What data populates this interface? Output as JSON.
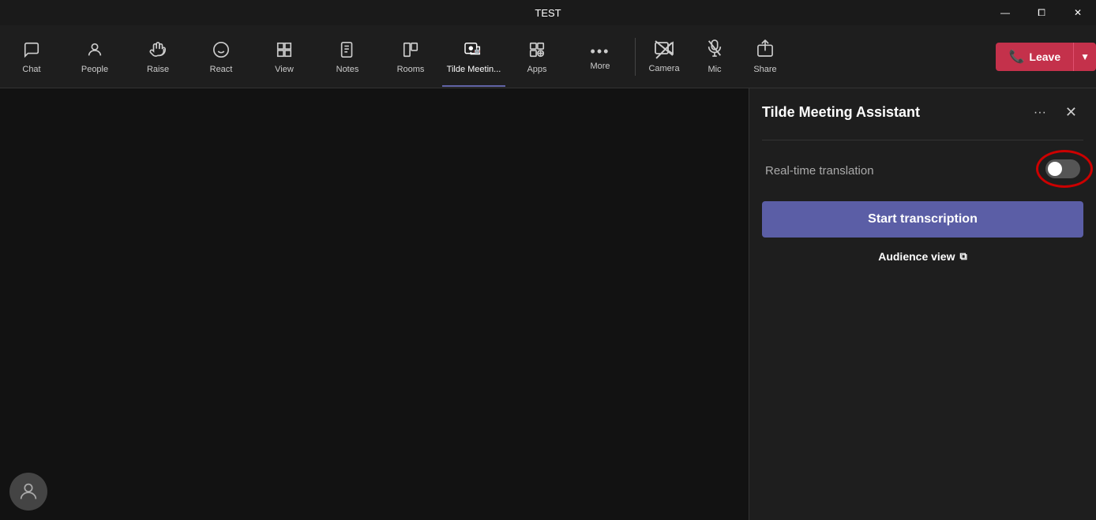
{
  "titlebar": {
    "title": "TEST",
    "minimize": "—",
    "maximize": "⧠",
    "close": "✕"
  },
  "toolbar": {
    "nav_items": [
      {
        "id": "chat",
        "label": "Chat",
        "icon": "💬",
        "active": false
      },
      {
        "id": "people",
        "label": "People",
        "icon": "👤",
        "active": false
      },
      {
        "id": "raise",
        "label": "Raise",
        "icon": "✋",
        "active": false
      },
      {
        "id": "react",
        "label": "React",
        "icon": "😊",
        "active": false
      },
      {
        "id": "view",
        "label": "View",
        "icon": "⊞",
        "active": false
      },
      {
        "id": "notes",
        "label": "Notes",
        "icon": "📋",
        "active": false
      },
      {
        "id": "rooms",
        "label": "Rooms",
        "icon": "⬜",
        "active": false
      },
      {
        "id": "tilde",
        "label": "Tilde Meetin...",
        "icon": "🤖",
        "active": true
      },
      {
        "id": "apps",
        "label": "Apps",
        "icon": "➕",
        "active": false
      },
      {
        "id": "more",
        "label": "More",
        "icon": "···",
        "active": false
      }
    ],
    "controls": [
      {
        "id": "camera",
        "label": "Camera",
        "crossed": true
      },
      {
        "id": "mic",
        "label": "Mic",
        "crossed": true
      },
      {
        "id": "share",
        "label": "Share",
        "crossed": false
      }
    ],
    "leave_label": "Leave",
    "leave_icon": "📞"
  },
  "panel": {
    "title": "Tilde Meeting Assistant",
    "more_icon": "···",
    "close_icon": "✕",
    "translation_label": "Real-time translation",
    "toggle_state": "off",
    "transcription_btn": "Start transcription",
    "audience_view_label": "Audience view",
    "audience_view_icon": "⧉"
  }
}
